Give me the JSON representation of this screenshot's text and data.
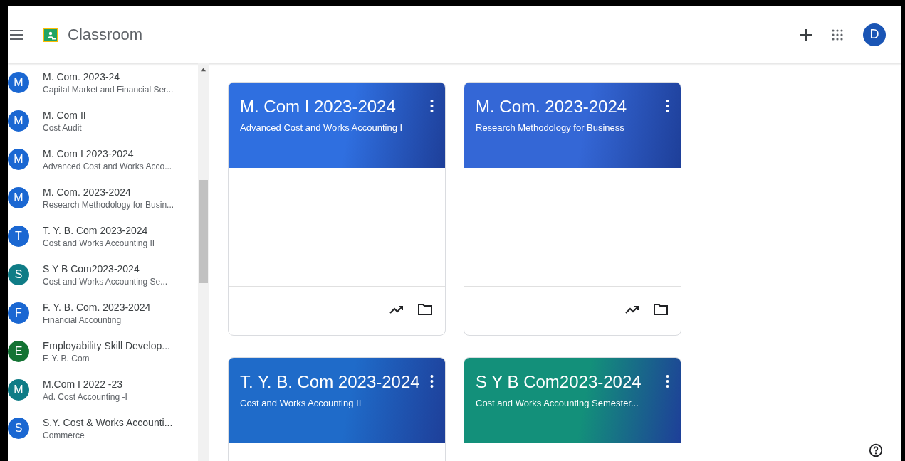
{
  "header": {
    "app_name": "Classroom",
    "account_initial": "D"
  },
  "sidebar": {
    "items": [
      {
        "initial": "M",
        "title": "M. Com. 2023-24",
        "subtitle": "Capital Market and Financial Ser...",
        "color": "#1a67d2"
      },
      {
        "initial": "M",
        "title": "M. Com II",
        "subtitle": "Cost Audit",
        "color": "#1a67d2"
      },
      {
        "initial": "M",
        "title": "M. Com I 2023-2024",
        "subtitle": "Advanced Cost and Works Acco...",
        "color": "#1a67d2"
      },
      {
        "initial": "M",
        "title": "M. Com. 2023-2024",
        "subtitle": "Research Methodology for Busin...",
        "color": "#1a67d2"
      },
      {
        "initial": "T",
        "title": "T. Y. B. Com 2023-2024",
        "subtitle": "Cost and Works Accounting II",
        "color": "#1a67d2"
      },
      {
        "initial": "S",
        "title": "S Y B Com2023-2024",
        "subtitle": "Cost and Works Accounting Se...",
        "color": "#0f7c86"
      },
      {
        "initial": "F",
        "title": "F. Y. B. Com. 2023-2024",
        "subtitle": "Financial Accounting",
        "color": "#1a67d2"
      },
      {
        "initial": "E",
        "title": "Employability Skill Develop...",
        "subtitle": "F. Y. B. Com",
        "color": "#137333"
      },
      {
        "initial": "M",
        "title": "M.Com I 2022 -23",
        "subtitle": "Ad. Cost Accounting -I",
        "color": "#0f7c86"
      },
      {
        "initial": "S",
        "title": "S.Y. Cost & Works Accounti...",
        "subtitle": "Commerce",
        "color": "#1a67d2"
      }
    ]
  },
  "cards": [
    {
      "title": "M. Com I 2023-2024",
      "subtitle": "Advanced Cost and Works Accounting I",
      "color": "#2f6fe0"
    },
    {
      "title": "M. Com. 2023-2024",
      "subtitle": "Research Methodology for Business",
      "color": "#3467d6"
    },
    {
      "title": "T. Y. B. Com 2023-2024",
      "subtitle": "Cost and Works Accounting II",
      "color": "#1f6bc9"
    },
    {
      "title": "S Y B Com2023-2024",
      "subtitle": "Cost and Works Accounting Semester...",
      "color": "#13907a"
    }
  ]
}
